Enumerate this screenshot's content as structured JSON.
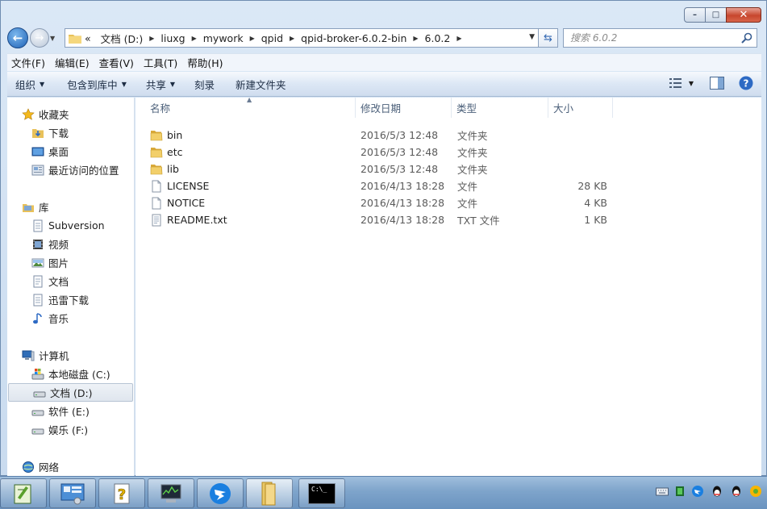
{
  "window": {
    "caption_buttons": {
      "minimize": "–",
      "maximize": "□",
      "close": "✕"
    }
  },
  "address": {
    "overflow": "«",
    "crumbs": [
      "文档 (D:)",
      "liuxg",
      "mywork",
      "qpid",
      "qpid-broker-6.0.2-bin",
      "6.0.2"
    ],
    "search_placeholder": "搜索 6.0.2"
  },
  "menu": [
    "文件(F)",
    "编辑(E)",
    "查看(V)",
    "工具(T)",
    "帮助(H)"
  ],
  "commands": {
    "organize": "组织",
    "include_in_library": "包含到库中",
    "share": "共享",
    "burn": "刻录",
    "new_folder": "新建文件夹"
  },
  "nav": {
    "favorites": {
      "label": "收藏夹",
      "items": [
        "下载",
        "桌面",
        "最近访问的位置"
      ]
    },
    "libraries": {
      "label": "库",
      "items": [
        "Subversion",
        "视频",
        "图片",
        "文档",
        "迅雷下载",
        "音乐"
      ]
    },
    "computer": {
      "label": "计算机",
      "items": [
        "本地磁盘 (C:)",
        "文档 (D:)",
        "软件 (E:)",
        "娱乐 (F:)"
      ],
      "selected": "文档 (D:)"
    },
    "network": {
      "label": "网络"
    }
  },
  "columns": [
    "名称",
    "修改日期",
    "类型",
    "大小"
  ],
  "files": [
    {
      "name": "bin",
      "date": "2016/5/3 12:48",
      "type": "文件夹",
      "size": "",
      "kind": "folder"
    },
    {
      "name": "etc",
      "date": "2016/5/3 12:48",
      "type": "文件夹",
      "size": "",
      "kind": "folder"
    },
    {
      "name": "lib",
      "date": "2016/5/3 12:48",
      "type": "文件夹",
      "size": "",
      "kind": "folder"
    },
    {
      "name": "LICENSE",
      "date": "2016/4/13 18:28",
      "type": "文件",
      "size": "28 KB",
      "kind": "file"
    },
    {
      "name": "NOTICE",
      "date": "2016/4/13 18:28",
      "type": "文件",
      "size": "4 KB",
      "kind": "file"
    },
    {
      "name": "README.txt",
      "date": "2016/4/13 18:28",
      "type": "TXT 文件",
      "size": "1 KB",
      "kind": "text"
    }
  ],
  "taskbar": {
    "cmd_label": "C:\\_"
  }
}
